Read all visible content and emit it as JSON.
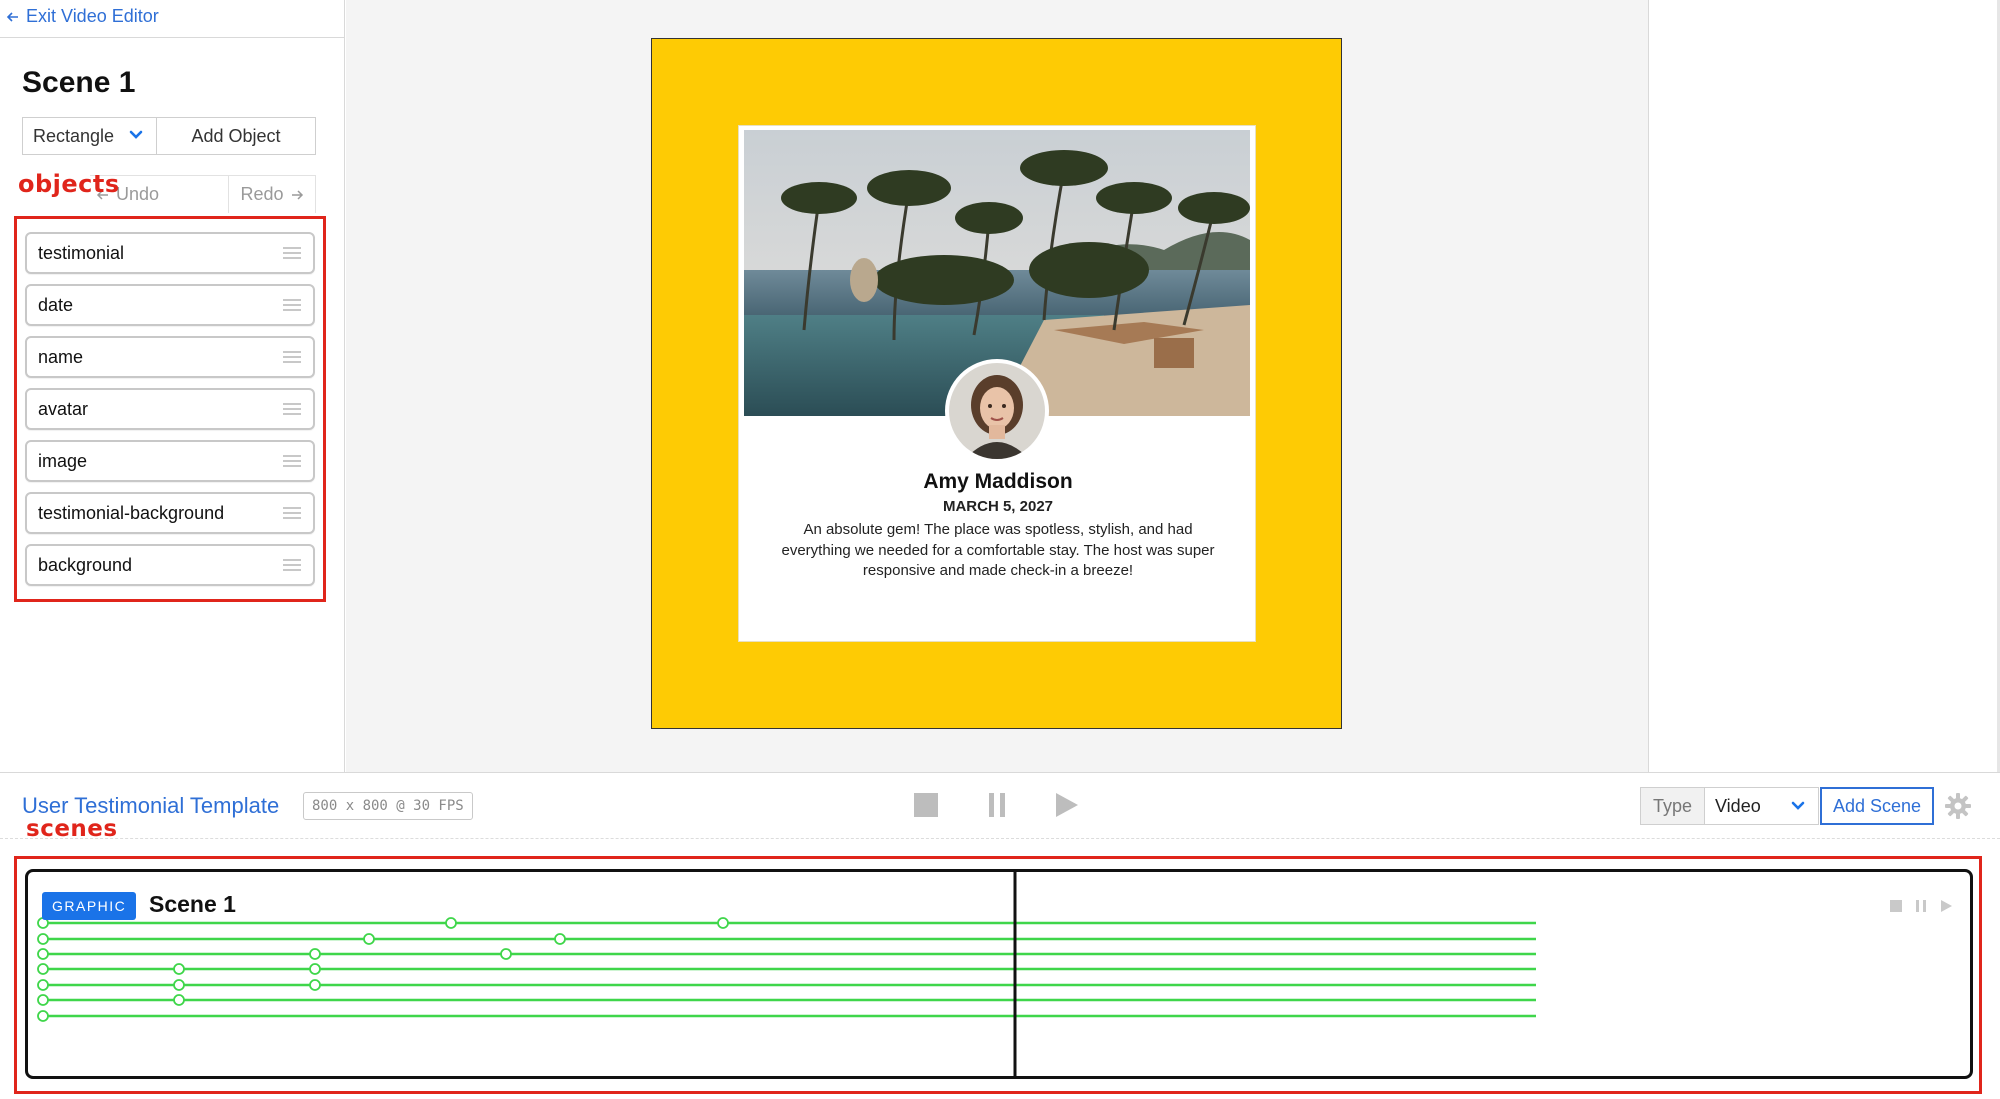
{
  "header": {
    "exit_label": "Exit Video Editor"
  },
  "sidebar": {
    "scene_title": "Scene 1",
    "object_type": "Rectangle",
    "add_object_label": "Add Object",
    "undo_label": "Undo",
    "redo_label": "Redo",
    "annotation_label": "objects",
    "objects": [
      {
        "label": "testimonial"
      },
      {
        "label": "date"
      },
      {
        "label": "name"
      },
      {
        "label": "avatar"
      },
      {
        "label": "image"
      },
      {
        "label": "testimonial-background"
      },
      {
        "label": "background"
      }
    ]
  },
  "canvas": {
    "background_color": "#fecb04",
    "person_name": "Amy Maddison",
    "date": "MARCH 5, 2027",
    "quote": "An absolute gem! The place was spotless, stylish, and had everything we needed for a comfortable stay. The host was super responsive and made check-in a breeze!"
  },
  "toolbar": {
    "project_title": "User Testimonial Template",
    "project_meta": "800 x 800 @ 30 FPS",
    "type_label": "Type",
    "type_value": "Video",
    "add_scene_label": "Add Scene",
    "annotation_label": "scenes"
  },
  "scenes": [
    {
      "badge": "GRAPHIC",
      "title": "Scene 1"
    }
  ],
  "colors": {
    "accent": "#1a73e8",
    "link": "#2f6fd6",
    "annotation": "#e0251b",
    "timeline": "#3fd64a"
  }
}
